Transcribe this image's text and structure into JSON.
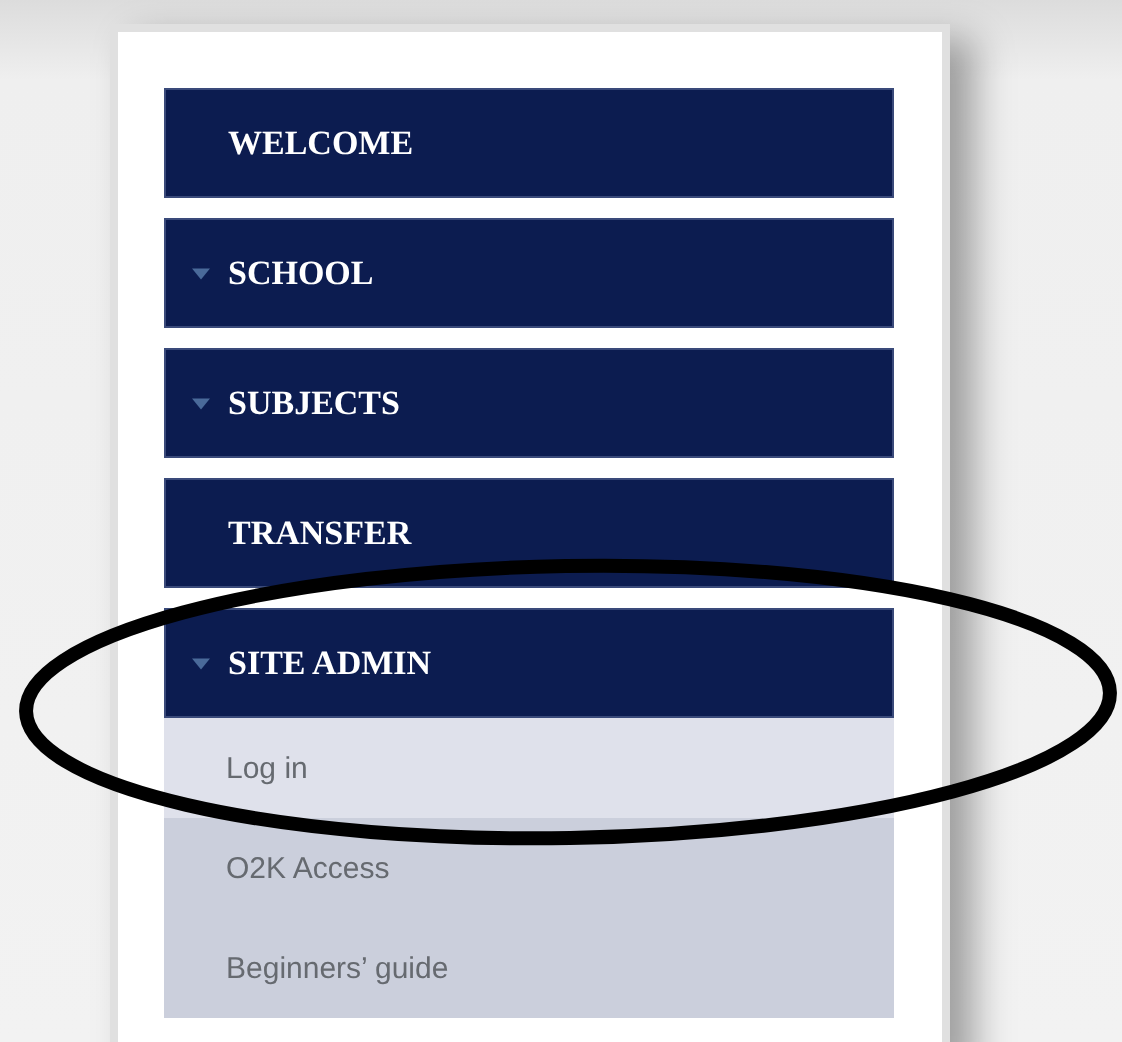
{
  "menu": [
    {
      "label": "WELCOME",
      "kind": "link"
    },
    {
      "label": "SCHOOL",
      "kind": "section"
    },
    {
      "label": "SUBJECTS",
      "kind": "section"
    },
    {
      "label": "TRANSFER",
      "kind": "link"
    },
    {
      "label": "SITE ADMIN",
      "kind": "section",
      "children": [
        {
          "label": "Log in",
          "selected": true
        },
        {
          "label": "O2K Access",
          "selected": false
        },
        {
          "label": "Beginners’ guide",
          "selected": false
        }
      ]
    }
  ],
  "annotation": {
    "kind": "ellipse"
  }
}
